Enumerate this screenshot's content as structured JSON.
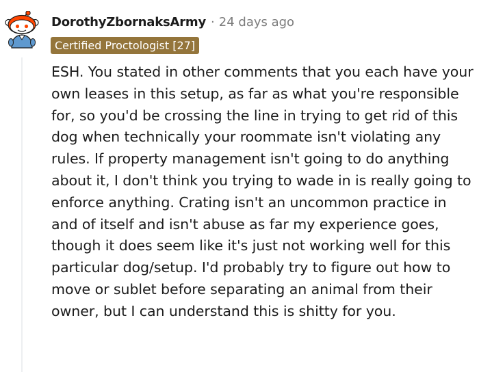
{
  "comment": {
    "username": "DorothyZbornaksArmy",
    "separator": "·",
    "time_ago": "24 days ago",
    "flair": "Certified Proctologist [27]",
    "body": "ESH. You stated in other comments that you each have your own leases in this setup, as far as what you're responsible for, so you'd be crossing the line in trying to get rid of this dog when technically your roommate isn't violating any rules. If property management isn't going to do anything about it, I don't think you trying to wade in is really going to enforce anything. Crating isn't an uncommon practice in and of itself and isn't abuse as far my experience goes, though it does seem like it's just not working well for this particular dog/setup. I'd probably try to figure out how to move or sublet before separating an animal from their owner, but I can understand this is shitty for you."
  },
  "colors": {
    "flair_background": "#94753b",
    "text": "#1c1c1c",
    "meta_text": "#7c7c7c",
    "thread_line": "#edeff1"
  },
  "icons": {
    "avatar": "snoo-avatar-icon"
  }
}
